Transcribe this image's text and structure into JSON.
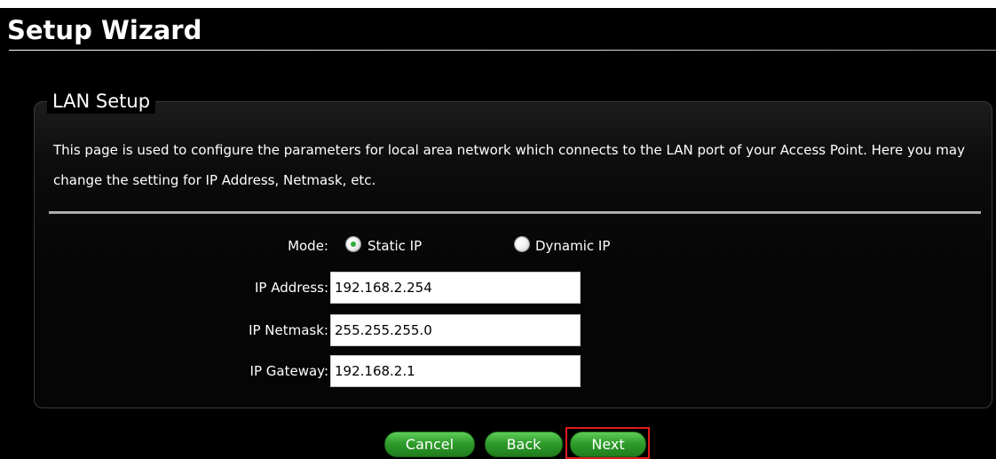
{
  "page": {
    "title": "Setup Wizard"
  },
  "panel": {
    "legend": "LAN Setup",
    "description": "This page is used to configure the parameters for local area network which connects to the LAN port of your Access Point. Here you may change the setting for IP Address, Netmask, etc."
  },
  "mode": {
    "label": "Mode:",
    "options": [
      {
        "label": "Static IP",
        "selected": true
      },
      {
        "label": "Dynamic IP",
        "selected": false
      }
    ]
  },
  "fields": {
    "ip_address": {
      "label": "IP Address:",
      "value": "192.168.2.254"
    },
    "ip_netmask": {
      "label": "IP Netmask:",
      "value": "255.255.255.0"
    },
    "ip_gateway": {
      "label": "IP Gateway:",
      "value": "192.168.2.1"
    }
  },
  "buttons": {
    "cancel": "Cancel",
    "back": "Back",
    "next": "Next"
  },
  "colors": {
    "background": "#000000",
    "button_green": "#2f9d2b",
    "focus_outline": "#e01b1b",
    "radio_selected": "#2fae3a"
  }
}
